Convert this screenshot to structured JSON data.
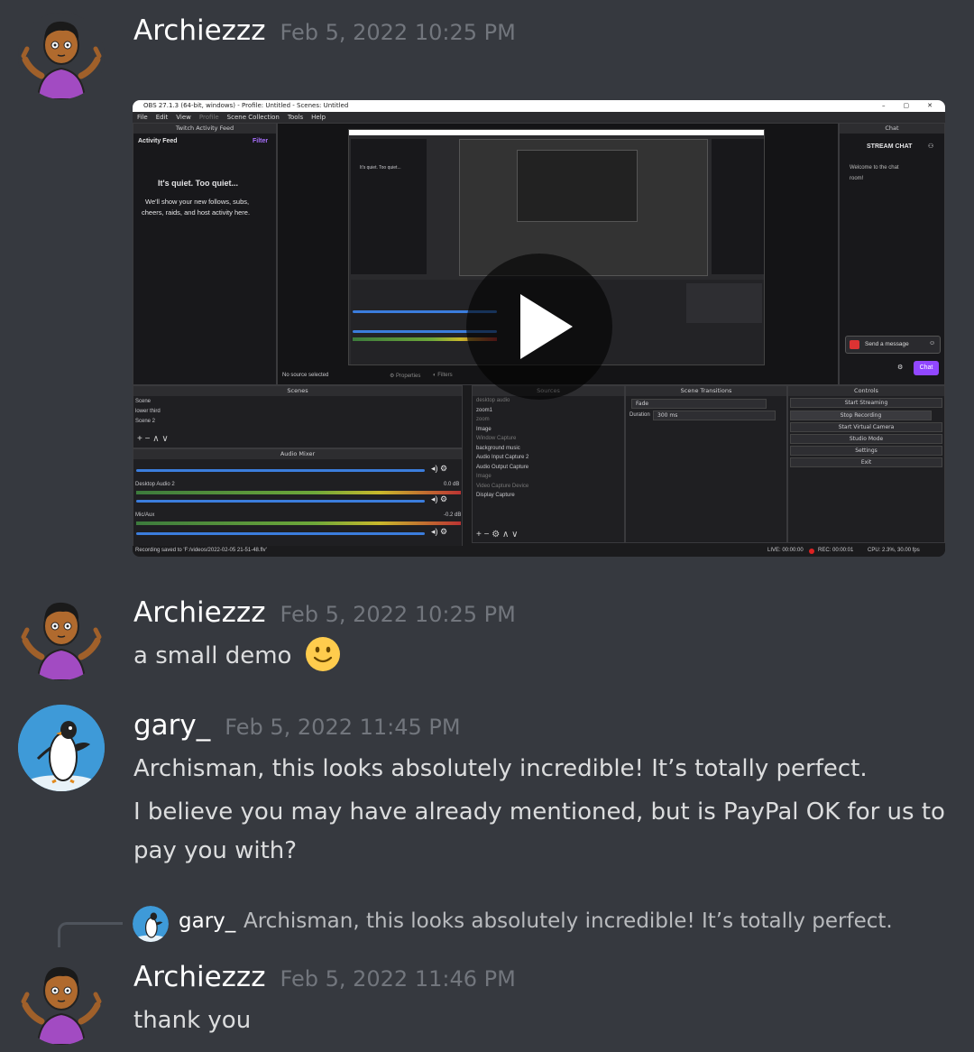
{
  "messages": [
    {
      "author": "Archiezzz",
      "timestamp": "Feb 5, 2022 10:25 PM"
    },
    {
      "author": "Archiezzz",
      "timestamp": "Feb 5, 2022 10:25 PM",
      "text": "a small demo"
    },
    {
      "author": "gary_",
      "timestamp": "Feb 5, 2022 11:45 PM",
      "lines": [
        "Archisman, this looks absolutely incredible! It’s totally perfect.",
        "I believe you may have already mentioned, but is PayPal OK for us to",
        "pay you with?"
      ]
    },
    {
      "author": "Archiezzz",
      "timestamp": "Feb 5, 2022 11:46 PM",
      "text": "thank you",
      "reply": {
        "author": "gary_",
        "text": "Archisman, this looks absolutely incredible! It’s totally perfect."
      }
    }
  ],
  "emoji": "slightly-smiling-face",
  "video": {
    "window_title": "OBS 27.1.3 (64-bit, windows) - Profile: Untitled - Scenes: Untitled",
    "menu": [
      "File",
      "Edit",
      "View",
      "Profile",
      "Scene Collection",
      "Tools",
      "Help"
    ],
    "activity_dock_title": "Twitch Activity Feed",
    "activity_feed": "Activity Feed",
    "filter": "Filter",
    "quiet_title": "It's quiet. Too quiet...",
    "quiet_body_1": "We'll show your new follows, subs,",
    "quiet_body_2": "cheers, raids, and host activity here.",
    "chat_dock_title": "Chat",
    "stream_chat": "STREAM CHAT",
    "welcome_1": "Welcome to the chat",
    "welcome_2": "room!",
    "send_message": "Send a message",
    "chat_button": "Chat",
    "no_source": "No source selected",
    "properties": "Properties",
    "filters": "Filters",
    "scenes_title": "Scenes",
    "scenes": [
      "Scene",
      "lower third",
      "Scene 2"
    ],
    "sources_title": "Sources",
    "sources": [
      "desktop audio",
      "zoom1",
      "zoom",
      "Image",
      "Window Capture",
      "background music",
      "Audio Input Capture 2",
      "Audio Output Capture",
      "Image",
      "Video Capture Device",
      "Display Capture"
    ],
    "audio_mixer_title": "Audio Mixer",
    "mixer_1": "Desktop Audio 2",
    "mixer_1_db": "0.0 dB",
    "mixer_2": "Mic/Aux",
    "mixer_2_db": "-0.2 dB",
    "transitions_title": "Scene Transitions",
    "transition": "Fade",
    "duration_label": "Duration",
    "duration": "300 ms",
    "controls_title": "Controls",
    "controls": [
      "Start Streaming",
      "Stop Recording",
      "Start Virtual Camera",
      "Studio Mode",
      "Settings",
      "Exit"
    ],
    "status_saved": "Recording saved to 'F:/videos/2022-02-05 21-51-48.flv'",
    "status_live": "LIVE: 00:00:00",
    "status_rec": "REC: 00:00:01",
    "status_cpu": "CPU: 2.3%, 30.00 fps"
  }
}
